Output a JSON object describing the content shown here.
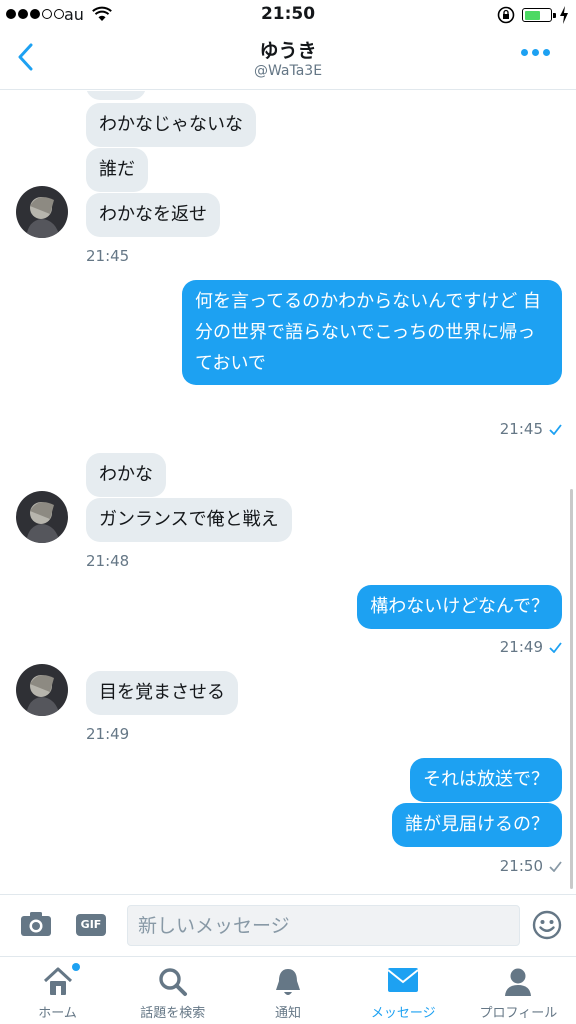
{
  "status_bar": {
    "carrier": "au",
    "time": "21:50",
    "battery_level": 0.6
  },
  "header": {
    "name": "ゆうき",
    "handle": "@WaTa3E"
  },
  "messages": [
    {
      "text": "わかなじゃないな"
    },
    {
      "text": "誰だ"
    },
    {
      "text": "わかなを返せ"
    },
    {
      "time": "21:45"
    },
    {
      "text": "何を言ってるのかわからないんですけど\n自分の世界で語らないでこっちの世界に帰っておいで"
    },
    {
      "time": "21:45"
    },
    {
      "text": "わかな"
    },
    {
      "text": "ガンランスで俺と戦え"
    },
    {
      "time": "21:48"
    },
    {
      "text": "構わないけどなんで？"
    },
    {
      "time": "21:49"
    },
    {
      "text": "目を覚まさせる"
    },
    {
      "time": "21:49"
    },
    {
      "text": "それは放送で？"
    },
    {
      "text": "誰が見届けるの？"
    },
    {
      "time": "21:50"
    }
  ],
  "composer": {
    "placeholder": "新しいメッセージ",
    "gif_label": "GIF"
  },
  "tabs": [
    {
      "label": "ホーム"
    },
    {
      "label": "話題を検索"
    },
    {
      "label": "通知"
    },
    {
      "label": "メッセージ"
    },
    {
      "label": "プロフィール"
    }
  ],
  "colors": {
    "accent": "#1da1f2",
    "incoming_bubble": "#e6ecf0",
    "muted": "#657786"
  },
  "icons": [
    "back-chevron-icon",
    "more-dots-icon",
    "camera-icon",
    "gif-icon",
    "emoji-icon",
    "home-icon",
    "search-icon",
    "bell-icon",
    "envelope-icon",
    "person-icon",
    "check-icon"
  ]
}
